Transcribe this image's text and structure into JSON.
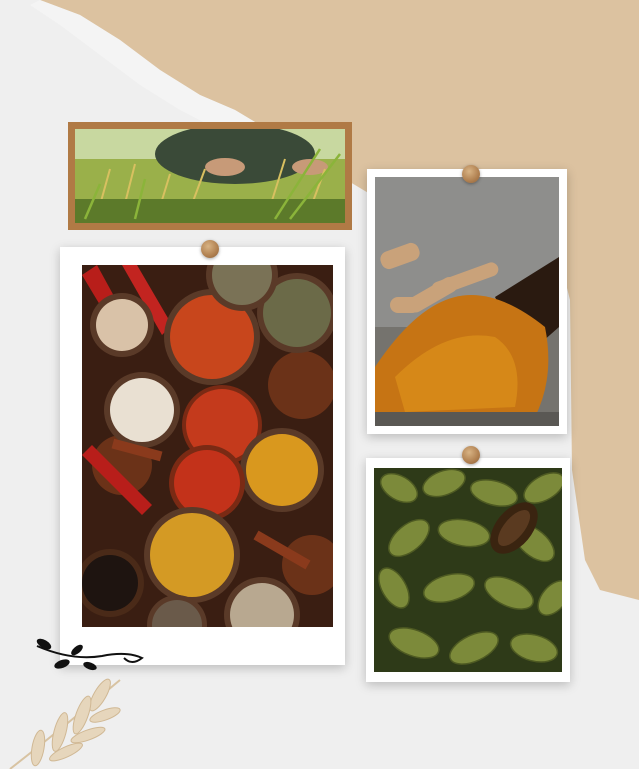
{
  "colors": {
    "background": "#efefef",
    "paper_tan": "#dcc2a0",
    "pin": "#b08050",
    "frame_brown": "#b07a45",
    "frame_white": "#ffffff"
  },
  "photos": [
    {
      "subject": "rice-harvest",
      "frame": "brown"
    },
    {
      "subject": "spice-bowls",
      "frame": "white-torn"
    },
    {
      "subject": "turmeric-root-and-powder",
      "frame": "white"
    },
    {
      "subject": "green-cardamom-pods",
      "frame": "white-torn"
    }
  ],
  "decorations": [
    "black-vine-doodle",
    "beige-leaf-branch",
    "tan-torn-paper"
  ]
}
